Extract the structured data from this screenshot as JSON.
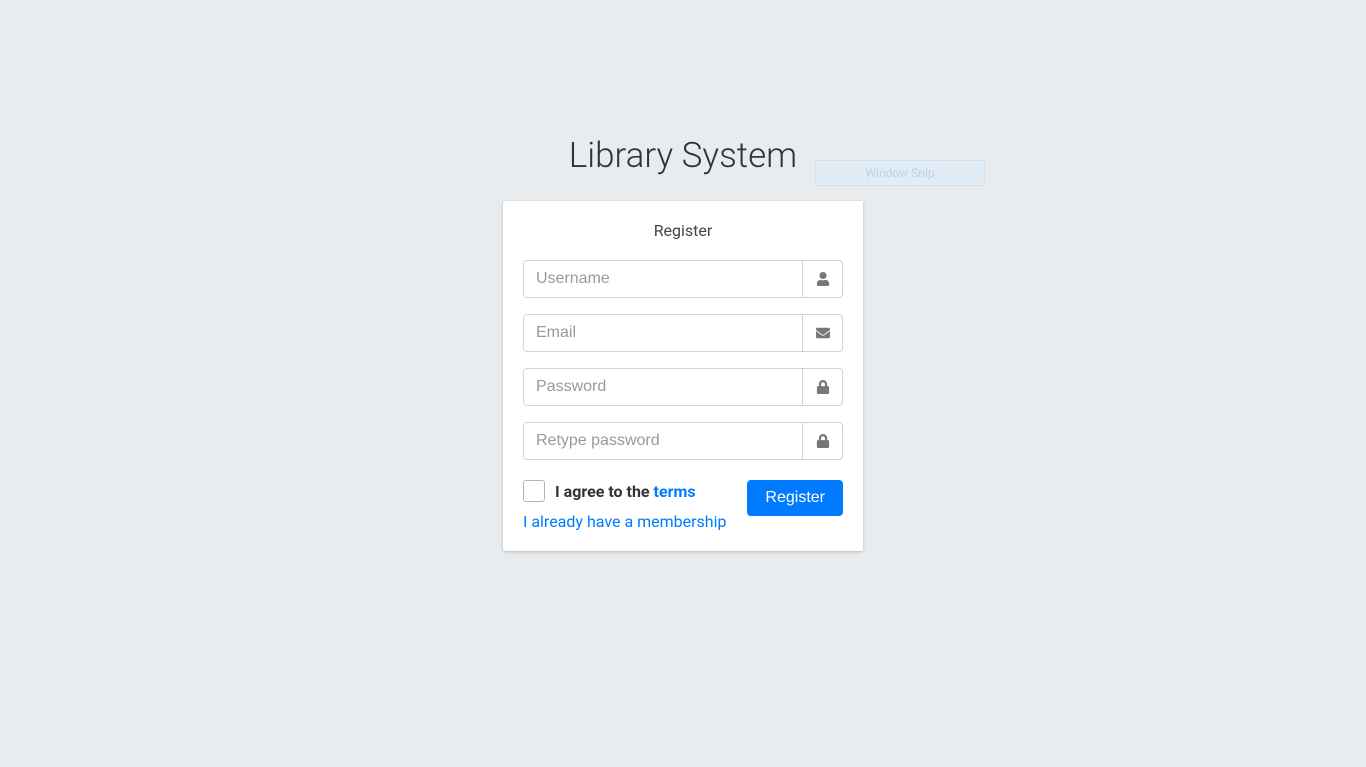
{
  "page": {
    "title": "Library System"
  },
  "card": {
    "heading": "Register"
  },
  "fields": {
    "username": {
      "placeholder": "Username",
      "value": ""
    },
    "email": {
      "placeholder": "Email",
      "value": ""
    },
    "password": {
      "placeholder": "Password",
      "value": ""
    },
    "retype_password": {
      "placeholder": "Retype password",
      "value": ""
    }
  },
  "terms": {
    "label_prefix": "I agree to the ",
    "link_text": "terms"
  },
  "membership_link": "I already have a membership",
  "button": {
    "register_label": "Register"
  },
  "overlay": {
    "text": "Window Snip"
  }
}
